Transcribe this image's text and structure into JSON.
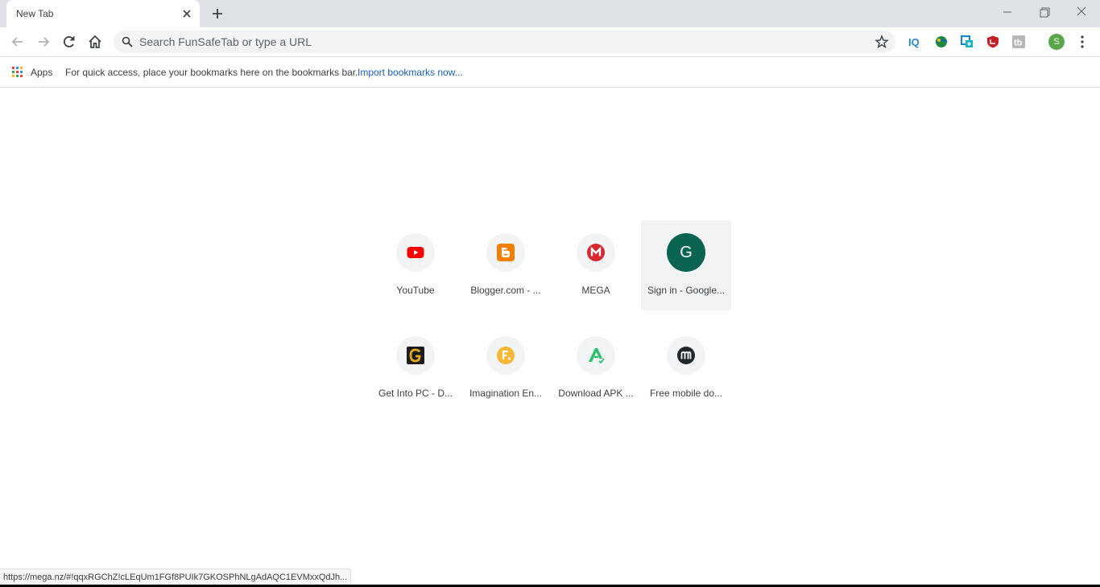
{
  "tab": {
    "title": "New Tab"
  },
  "omnibox": {
    "placeholder": "Search FunSafeTab or type a URL"
  },
  "toolbar": {
    "avatar_letter": "S"
  },
  "bookmarks_bar": {
    "apps_label": "Apps",
    "message": "For quick access, place your bookmarks here on the bookmarks bar.",
    "import_link": "Import bookmarks now..."
  },
  "shortcuts": [
    {
      "title": "YouTube"
    },
    {
      "title": "Blogger.com - ..."
    },
    {
      "title": "MEGA"
    },
    {
      "title": "Sign in - Google...",
      "letter": "G"
    },
    {
      "title": "Get Into PC - D..."
    },
    {
      "title": "Imagination En..."
    },
    {
      "title": "Download APK ..."
    },
    {
      "title": "Free mobile do..."
    }
  ],
  "status_bar": {
    "url": "https://mega.nz/#!qqxRGChZ!cLEqUm1FGf8PUIk7GKOSPhNLgAdAQC1EVMxxQdJh..."
  },
  "colors": {
    "accent": "#1a73e8",
    "tabstrip": "#dee1e6",
    "omnibox": "#f1f3f4"
  }
}
